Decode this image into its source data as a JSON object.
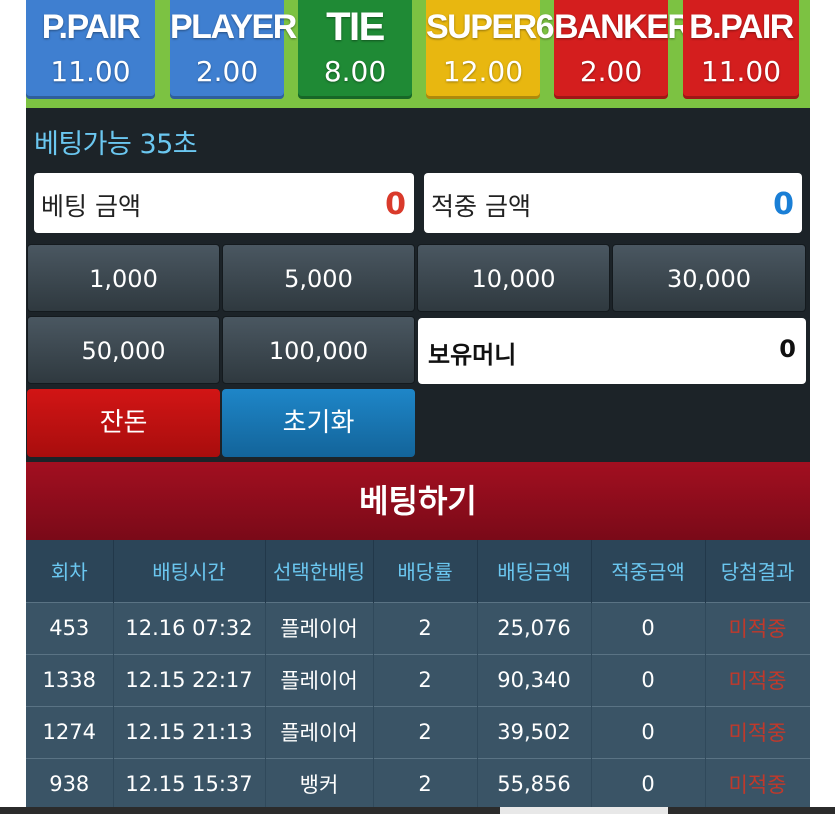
{
  "bet_options": [
    {
      "id": "p-pair",
      "name": "P.PAIR",
      "odds": "11.00",
      "color": "#3f7fd0"
    },
    {
      "id": "player",
      "name": "PLAYER",
      "odds": "2.00",
      "color": "#3f7fd0"
    },
    {
      "id": "tie",
      "name": "TIE",
      "odds": "8.00",
      "color": "#1f8a35"
    },
    {
      "id": "super6",
      "name": "SUPER6",
      "odds": "12.00",
      "color": "#e8b710"
    },
    {
      "id": "banker",
      "name": "BANKER",
      "odds": "2.00",
      "color": "#d41e1e"
    },
    {
      "id": "b-pair",
      "name": "B.PAIR",
      "odds": "11.00",
      "color": "#d41e1e"
    }
  ],
  "bet_time_text": "베팅가능 35초",
  "bet_amount": {
    "label": "베팅 금액",
    "value": "0",
    "color": "#d93a2b"
  },
  "win_amount": {
    "label": "적중 금액",
    "value": "0",
    "color": "#1a7fd6"
  },
  "chips": [
    "1,000",
    "5,000",
    "10,000",
    "30,000",
    "50,000",
    "100,000"
  ],
  "balance": {
    "label": "보유머니",
    "value": "0"
  },
  "buttons": {
    "change": "잔돈",
    "reset": "초기화",
    "place_bet": "베팅하기"
  },
  "history": {
    "headers": [
      "회차",
      "배팅시간",
      "선택한배팅",
      "배당률",
      "배팅금액",
      "적중금액",
      "당첨결과"
    ],
    "rows": [
      [
        "453",
        "12.16 07:32",
        "플레이어",
        "2",
        "25,076",
        "0",
        "미적중"
      ],
      [
        "1338",
        "12.15 22:17",
        "플레이어",
        "2",
        "90,340",
        "0",
        "미적중"
      ],
      [
        "1274",
        "12.15 21:13",
        "플레이어",
        "2",
        "39,502",
        "0",
        "미적중"
      ],
      [
        "938",
        "12.15 15:37",
        "뱅커",
        "2",
        "55,856",
        "0",
        "미적중"
      ]
    ]
  }
}
